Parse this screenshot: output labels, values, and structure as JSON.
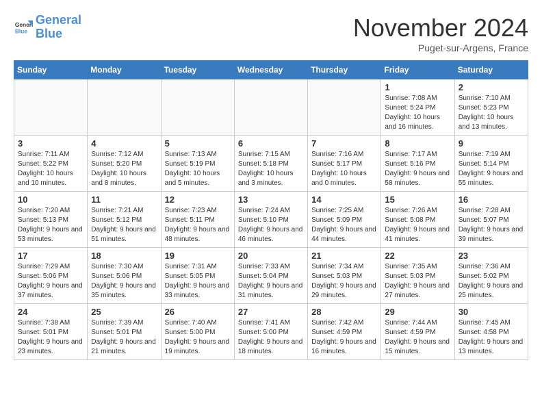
{
  "header": {
    "logo_line1": "General",
    "logo_line2": "Blue",
    "month": "November 2024",
    "location": "Puget-sur-Argens, France"
  },
  "days_of_week": [
    "Sunday",
    "Monday",
    "Tuesday",
    "Wednesday",
    "Thursday",
    "Friday",
    "Saturday"
  ],
  "weeks": [
    [
      {
        "day": "",
        "info": ""
      },
      {
        "day": "",
        "info": ""
      },
      {
        "day": "",
        "info": ""
      },
      {
        "day": "",
        "info": ""
      },
      {
        "day": "",
        "info": ""
      },
      {
        "day": "1",
        "info": "Sunrise: 7:08 AM\nSunset: 5:24 PM\nDaylight: 10 hours and 16 minutes."
      },
      {
        "day": "2",
        "info": "Sunrise: 7:10 AM\nSunset: 5:23 PM\nDaylight: 10 hours and 13 minutes."
      }
    ],
    [
      {
        "day": "3",
        "info": "Sunrise: 7:11 AM\nSunset: 5:22 PM\nDaylight: 10 hours and 10 minutes."
      },
      {
        "day": "4",
        "info": "Sunrise: 7:12 AM\nSunset: 5:20 PM\nDaylight: 10 hours and 8 minutes."
      },
      {
        "day": "5",
        "info": "Sunrise: 7:13 AM\nSunset: 5:19 PM\nDaylight: 10 hours and 5 minutes."
      },
      {
        "day": "6",
        "info": "Sunrise: 7:15 AM\nSunset: 5:18 PM\nDaylight: 10 hours and 3 minutes."
      },
      {
        "day": "7",
        "info": "Sunrise: 7:16 AM\nSunset: 5:17 PM\nDaylight: 10 hours and 0 minutes."
      },
      {
        "day": "8",
        "info": "Sunrise: 7:17 AM\nSunset: 5:16 PM\nDaylight: 9 hours and 58 minutes."
      },
      {
        "day": "9",
        "info": "Sunrise: 7:19 AM\nSunset: 5:14 PM\nDaylight: 9 hours and 55 minutes."
      }
    ],
    [
      {
        "day": "10",
        "info": "Sunrise: 7:20 AM\nSunset: 5:13 PM\nDaylight: 9 hours and 53 minutes."
      },
      {
        "day": "11",
        "info": "Sunrise: 7:21 AM\nSunset: 5:12 PM\nDaylight: 9 hours and 51 minutes."
      },
      {
        "day": "12",
        "info": "Sunrise: 7:23 AM\nSunset: 5:11 PM\nDaylight: 9 hours and 48 minutes."
      },
      {
        "day": "13",
        "info": "Sunrise: 7:24 AM\nSunset: 5:10 PM\nDaylight: 9 hours and 46 minutes."
      },
      {
        "day": "14",
        "info": "Sunrise: 7:25 AM\nSunset: 5:09 PM\nDaylight: 9 hours and 44 minutes."
      },
      {
        "day": "15",
        "info": "Sunrise: 7:26 AM\nSunset: 5:08 PM\nDaylight: 9 hours and 41 minutes."
      },
      {
        "day": "16",
        "info": "Sunrise: 7:28 AM\nSunset: 5:07 PM\nDaylight: 9 hours and 39 minutes."
      }
    ],
    [
      {
        "day": "17",
        "info": "Sunrise: 7:29 AM\nSunset: 5:06 PM\nDaylight: 9 hours and 37 minutes."
      },
      {
        "day": "18",
        "info": "Sunrise: 7:30 AM\nSunset: 5:06 PM\nDaylight: 9 hours and 35 minutes."
      },
      {
        "day": "19",
        "info": "Sunrise: 7:31 AM\nSunset: 5:05 PM\nDaylight: 9 hours and 33 minutes."
      },
      {
        "day": "20",
        "info": "Sunrise: 7:33 AM\nSunset: 5:04 PM\nDaylight: 9 hours and 31 minutes."
      },
      {
        "day": "21",
        "info": "Sunrise: 7:34 AM\nSunset: 5:03 PM\nDaylight: 9 hours and 29 minutes."
      },
      {
        "day": "22",
        "info": "Sunrise: 7:35 AM\nSunset: 5:03 PM\nDaylight: 9 hours and 27 minutes."
      },
      {
        "day": "23",
        "info": "Sunrise: 7:36 AM\nSunset: 5:02 PM\nDaylight: 9 hours and 25 minutes."
      }
    ],
    [
      {
        "day": "24",
        "info": "Sunrise: 7:38 AM\nSunset: 5:01 PM\nDaylight: 9 hours and 23 minutes."
      },
      {
        "day": "25",
        "info": "Sunrise: 7:39 AM\nSunset: 5:01 PM\nDaylight: 9 hours and 21 minutes."
      },
      {
        "day": "26",
        "info": "Sunrise: 7:40 AM\nSunset: 5:00 PM\nDaylight: 9 hours and 19 minutes."
      },
      {
        "day": "27",
        "info": "Sunrise: 7:41 AM\nSunset: 5:00 PM\nDaylight: 9 hours and 18 minutes."
      },
      {
        "day": "28",
        "info": "Sunrise: 7:42 AM\nSunset: 4:59 PM\nDaylight: 9 hours and 16 minutes."
      },
      {
        "day": "29",
        "info": "Sunrise: 7:44 AM\nSunset: 4:59 PM\nDaylight: 9 hours and 15 minutes."
      },
      {
        "day": "30",
        "info": "Sunrise: 7:45 AM\nSunset: 4:58 PM\nDaylight: 9 hours and 13 minutes."
      }
    ]
  ]
}
